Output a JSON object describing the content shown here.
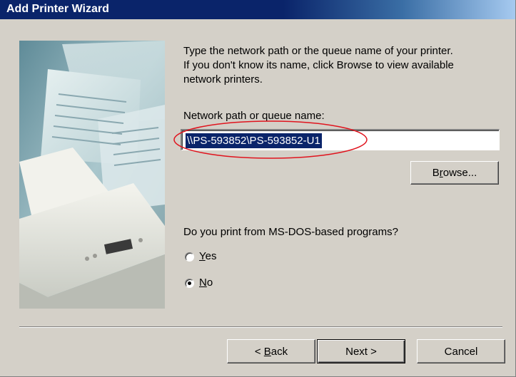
{
  "window": {
    "title": "Add Printer Wizard"
  },
  "instructions": {
    "line1": "Type the network path or the queue name of your printer.",
    "line2": "If you don't know its name, click Browse to view available",
    "line3": "network printers."
  },
  "network_path": {
    "label": "Network path or queue name:",
    "value": "\\\\PS-593852\\PS-593852-U1"
  },
  "browse_button": {
    "label_pre": "B",
    "label_accel": "r",
    "label_post": "owse..."
  },
  "msdos": {
    "question": "Do you print from MS-DOS-based programs?",
    "options": [
      {
        "accel": "Y",
        "rest": "es",
        "selected": false
      },
      {
        "accel": "N",
        "rest": "o",
        "selected": true
      }
    ]
  },
  "buttons": {
    "back": {
      "prefix": "< ",
      "accel": "B",
      "rest": "ack"
    },
    "next": "Next >",
    "cancel": "Cancel"
  },
  "colors": {
    "titlebar_start": "#0a246a",
    "titlebar_end": "#a6caf0",
    "selection": "#0a246a",
    "annotation": "#e0141e",
    "dialog_face": "#d4d0c8"
  },
  "icons": {
    "illustration": "printer-illustration"
  }
}
